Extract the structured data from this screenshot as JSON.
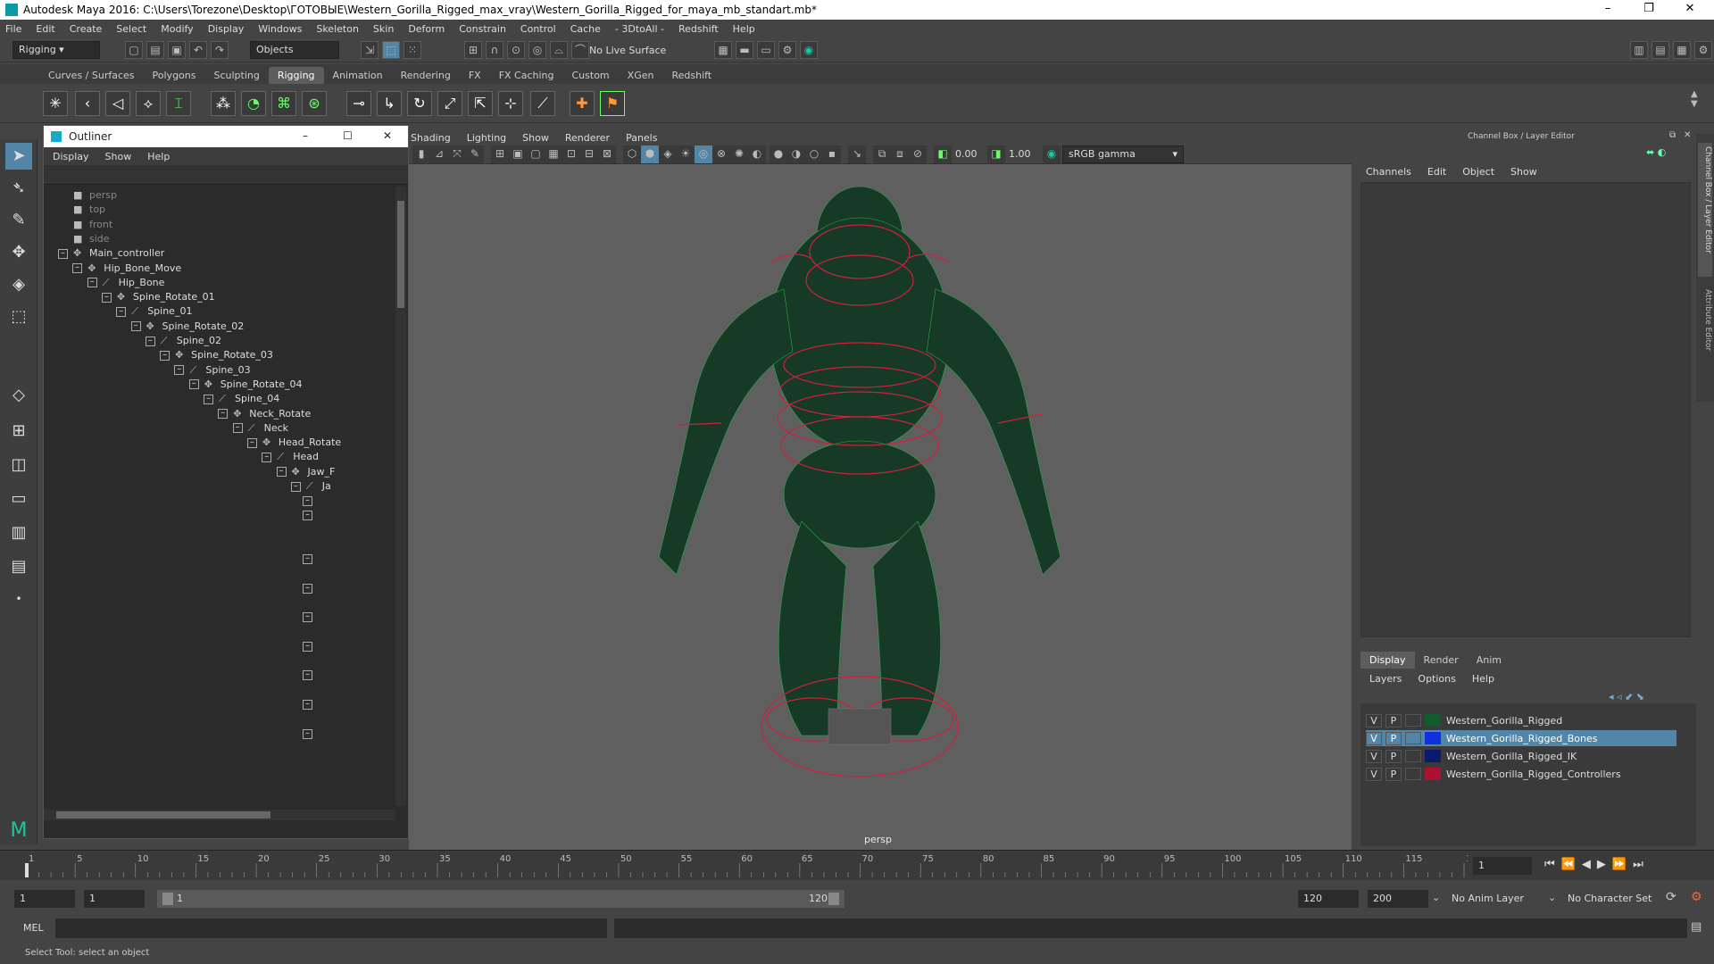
{
  "window": {
    "title": "Autodesk Maya 2016: C:\\Users\\Torezone\\Desktop\\ГОТОВЫЕ\\Western_Gorilla_Rigged_max_vray\\Western_Gorilla_Rigged_for_maya_mb_standart.mb*"
  },
  "menus": [
    "File",
    "Edit",
    "Create",
    "Select",
    "Modify",
    "Display",
    "Windows",
    "Skeleton",
    "Skin",
    "Deform",
    "Constrain",
    "Control",
    "Cache",
    "- 3DtoAll -",
    "Redshift",
    "Help"
  ],
  "statusline": {
    "menuset": "Rigging",
    "selection_mode": "Objects",
    "live_surface": "No Live Surface"
  },
  "shelf_tabs": [
    "Curves / Surfaces",
    "Polygons",
    "Sculpting",
    "Rigging",
    "Animation",
    "Rendering",
    "FX",
    "FX Caching",
    "Custom",
    "XGen",
    "Redshift"
  ],
  "shelf_active": "Rigging",
  "outliner": {
    "title": "Outliner",
    "menu": [
      "Display",
      "Show",
      "Help"
    ],
    "items": [
      {
        "label": "persp",
        "depth": 0,
        "type": "camera",
        "expander": false,
        "dim": true
      },
      {
        "label": "top",
        "depth": 0,
        "type": "camera",
        "expander": false,
        "dim": true
      },
      {
        "label": "front",
        "depth": 0,
        "type": "camera",
        "expander": false,
        "dim": true
      },
      {
        "label": "side",
        "depth": 0,
        "type": "camera",
        "expander": false,
        "dim": true
      },
      {
        "label": "Main_controller",
        "depth": 0,
        "type": "transform",
        "expander": true
      },
      {
        "label": "Hip_Bone_Move",
        "depth": 1,
        "type": "transform",
        "expander": true
      },
      {
        "label": "Hip_Bone",
        "depth": 2,
        "type": "joint",
        "expander": true
      },
      {
        "label": "Spine_Rotate_01",
        "depth": 3,
        "type": "transform",
        "expander": true
      },
      {
        "label": "Spine_01",
        "depth": 4,
        "type": "joint",
        "expander": true
      },
      {
        "label": "Spine_Rotate_02",
        "depth": 5,
        "type": "transform",
        "expander": true
      },
      {
        "label": "Spine_02",
        "depth": 6,
        "type": "joint",
        "expander": true
      },
      {
        "label": "Spine_Rotate_03",
        "depth": 7,
        "type": "transform",
        "expander": true
      },
      {
        "label": "Spine_03",
        "depth": 8,
        "type": "joint",
        "expander": true
      },
      {
        "label": "Spine_Rotate_04",
        "depth": 9,
        "type": "transform",
        "expander": true
      },
      {
        "label": "Spine_04",
        "depth": 10,
        "type": "joint",
        "expander": true
      },
      {
        "label": "Neck_Rotate",
        "depth": 11,
        "type": "transform",
        "expander": true
      },
      {
        "label": "Neck",
        "depth": 12,
        "type": "joint",
        "expander": true
      },
      {
        "label": "Head_Rotate",
        "depth": 13,
        "type": "transform",
        "expander": true
      },
      {
        "label": "Head",
        "depth": 14,
        "type": "joint",
        "expander": true
      },
      {
        "label": "Jaw_F",
        "depth": 15,
        "type": "transform",
        "expander": true
      },
      {
        "label": "Ja",
        "depth": 16,
        "type": "joint",
        "expander": true
      }
    ]
  },
  "viewport": {
    "menu": [
      "Shading",
      "Lighting",
      "Show",
      "Renderer",
      "Panels"
    ],
    "camera_label": "persp",
    "field_a": "0.00",
    "field_b": "1.00",
    "color_space": "sRGB gamma"
  },
  "channelbox": {
    "title": "Channel Box / Layer Editor",
    "menu": [
      "Channels",
      "Edit",
      "Object",
      "Show"
    ],
    "side_tabs": [
      "Channel Box / Layer Editor",
      "Attribute Editor"
    ],
    "layer_tabs": [
      "Display",
      "Render",
      "Anim"
    ],
    "layer_menu": [
      "Layers",
      "Options",
      "Help"
    ],
    "layers": [
      {
        "v": "V",
        "p": "P",
        "color": "#0f5c2e",
        "name": "Western_Gorilla_Rigged",
        "selected": false
      },
      {
        "v": "V",
        "p": "P",
        "color": "#1030e0",
        "name": "Western_Gorilla_Rigged_Bones",
        "selected": true
      },
      {
        "v": "V",
        "p": "P",
        "color": "#0a1a6e",
        "name": "Western_Gorilla_Rigged_IK",
        "selected": false
      },
      {
        "v": "V",
        "p": "P",
        "color": "#b01030",
        "name": "Western_Gorilla_Rigged_Controllers",
        "selected": false
      }
    ]
  },
  "timeline": {
    "ticks": [
      "1",
      "5",
      "10",
      "15",
      "20",
      "25",
      "30",
      "35",
      "40",
      "45",
      "50",
      "55",
      "60",
      "65",
      "70",
      "75",
      "80",
      "85",
      "90",
      "95",
      "100",
      "105",
      "110",
      "115",
      "120"
    ],
    "current_frame": "1"
  },
  "range": {
    "start": "1",
    "playback_start": "1",
    "slider_start": "1",
    "slider_end": "120",
    "playback_end": "120",
    "end": "200",
    "anim_layer": "No Anim Layer",
    "character_set": "No Character Set"
  },
  "cmdline": {
    "label": "MEL"
  },
  "helpline": {
    "text": "Select Tool: select an object"
  },
  "colors": {
    "selected_row": "#5285a6",
    "wire_green": "#2ea84a",
    "control_red": "#d0203c"
  }
}
